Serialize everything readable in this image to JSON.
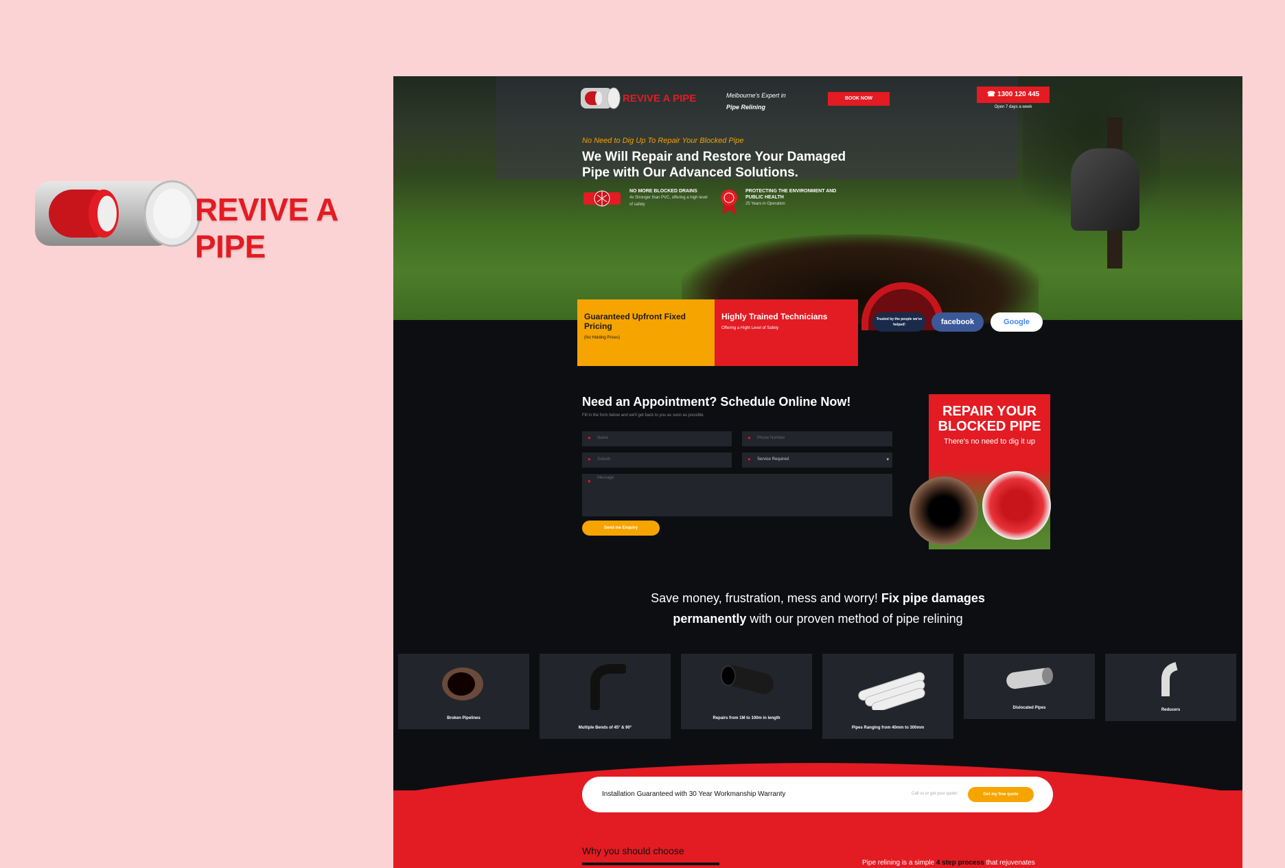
{
  "brand": {
    "name": "REVIVE A PIPE",
    "accent": "#e31b23",
    "secondary": "#f6a400"
  },
  "header": {
    "tagline_line1": "Melbourne's Expert in",
    "tagline_line2": "Pipe Relining",
    "book_label": "BOOK NOW",
    "phone_label": "☎ 1300 120 445",
    "phone_sub": "Open 7 days a week"
  },
  "hero": {
    "pre": "No Need to Dig Up To Repair Your Blocked Pipe",
    "headline": "We Will Repair and Restore Your Damaged Pipe with Our Advanced Solutions.",
    "features": [
      {
        "title": "NO MORE BLOCKED DRAINS",
        "sub": "4x Stronger than PVC, offering a high level of safety"
      },
      {
        "title": "PROTECTING THE ENVIRONMENT AND PUBLIC HEALTH",
        "sub": "25 Years in Operation"
      }
    ]
  },
  "usp": [
    {
      "title": "Guaranteed Upfront Fixed Pricing",
      "sub": "(No Hidding Prices)"
    },
    {
      "title": "Highly Trained Technicians",
      "sub": "Offering a Hight Level of Safety"
    }
  ],
  "badges": {
    "trust": "Trusted by the people we've helped!",
    "facebook": "facebook",
    "google": "Google"
  },
  "form": {
    "title": "Need an Appointment? Schedule Online Now!",
    "sub": "Fill in the form below and we'll get back to you as soon as possible.",
    "name_ph": "Name",
    "phone_ph": "Phone Number",
    "suburb_ph": "Suburb",
    "service_value": "Service Required",
    "message_ph": "Message",
    "send_label": "Send me Enquiry"
  },
  "promo": {
    "headline": "REPAIR YOUR BLOCKED PIPE",
    "sub": "There's no need to dig it up"
  },
  "save": {
    "part1": "Save money, frustration, mess and worry! ",
    "bold1": "Fix pipe damages",
    "bold2": "permanently",
    "part2": " with our proven method of pipe relining"
  },
  "products": [
    {
      "label": "Broken Pipelines"
    },
    {
      "label": "Multiple Bends of 45° & 90°"
    },
    {
      "label": "Repairs from 1M to 100m in length"
    },
    {
      "label": "Pipes Ranging from 40mm to 300mm"
    },
    {
      "label": "Dislocated Pipes"
    },
    {
      "label": "Reducers"
    }
  ],
  "warranty": {
    "text": "Installation Guaranteed with 30 Year Workmanship Warranty",
    "call": "Call us or get your quote!",
    "button": "Get my free quote"
  },
  "why": {
    "title": "Why you should choose",
    "process_pre": "Pipe relining is a simple ",
    "process_bold": "4 step process",
    "process_post": " that rejuvenates"
  }
}
